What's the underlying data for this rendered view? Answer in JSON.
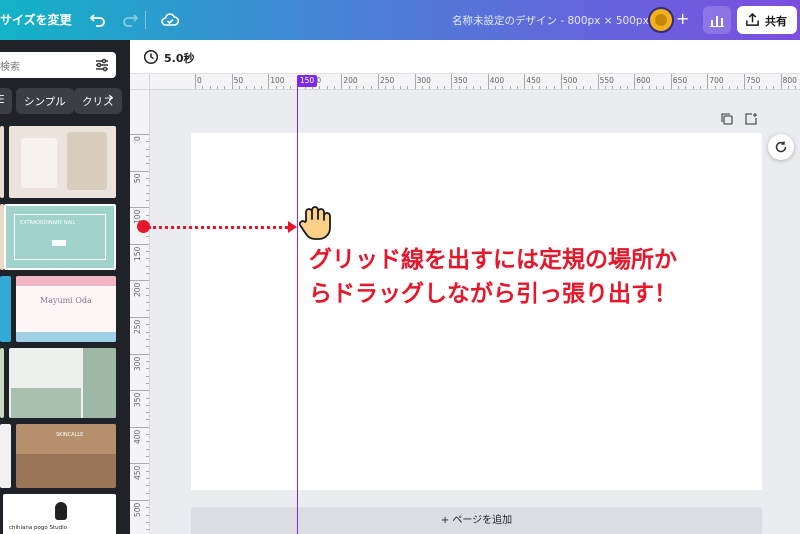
{
  "topbar": {
    "resize_label": "サイズを変更",
    "doc_title": "名称未設定のデザイン - 800px × 500px",
    "share_label": "共有",
    "plus_label": "+"
  },
  "panel": {
    "search_placeholder": "検索",
    "chips": [
      "E",
      "シンプル",
      "クリス"
    ],
    "chip_arrow": "›",
    "template_texts": {
      "mint_heading": "EXTRAORDINARY NAIL",
      "flower_name": "Mayumi Oda",
      "cafe_label": "SKINCALLE",
      "cat_footer": "chihiana pogo Studio"
    }
  },
  "toolbar": {
    "duration": "5.0秒"
  },
  "ruler": {
    "top_labels": [
      "0",
      "50",
      "100",
      "150",
      "200",
      "250",
      "300",
      "350",
      "400",
      "450",
      "500",
      "550",
      "600",
      "650",
      "700",
      "750",
      "800"
    ],
    "left_labels": [
      "0",
      "50",
      "100",
      "150",
      "200",
      "250",
      "300",
      "350",
      "400",
      "450",
      "500"
    ],
    "highlight": "150"
  },
  "canvas": {
    "add_page_label": "+ ページを追加"
  },
  "annotation": {
    "line1": "グリッド線を出すには定規の場所か",
    "line2": "らドラッグしながら引っ張り出す！"
  },
  "colors": {
    "guide": "#7d2ae8",
    "annotation": "#e8162b",
    "panel_bg": "#1f2226"
  }
}
